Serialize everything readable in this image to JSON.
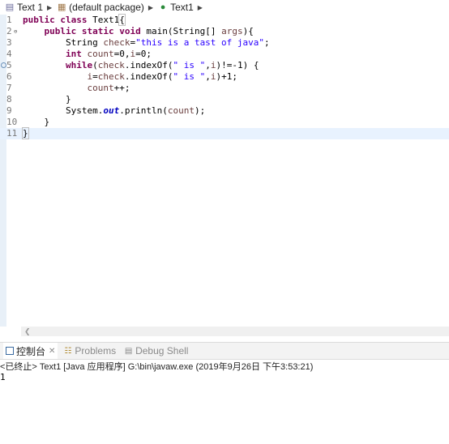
{
  "breadcrumb": {
    "items": [
      {
        "label": "Text 1",
        "icon": "project-icon"
      },
      {
        "label": "(default package)",
        "icon": "package-icon"
      },
      {
        "label": "Text1",
        "icon": "class-icon"
      }
    ]
  },
  "editor": {
    "line_numbers": [
      "1",
      "2",
      "3",
      "4",
      "5",
      "6",
      "7",
      "8",
      "9",
      "10",
      "11"
    ]
  },
  "views": {
    "tabs": [
      {
        "label": "控制台",
        "icon": "console-icon",
        "active": true
      },
      {
        "label": "Problems",
        "icon": "problems-icon",
        "active": false
      },
      {
        "label": "Debug Shell",
        "icon": "debug-shell-icon",
        "active": false
      }
    ]
  },
  "console": {
    "description": "<已终止> Text1 [Java 应用程序] G:\\bin\\javaw.exe  (2019年9月26日 下午3:53:21)",
    "output": "1"
  }
}
